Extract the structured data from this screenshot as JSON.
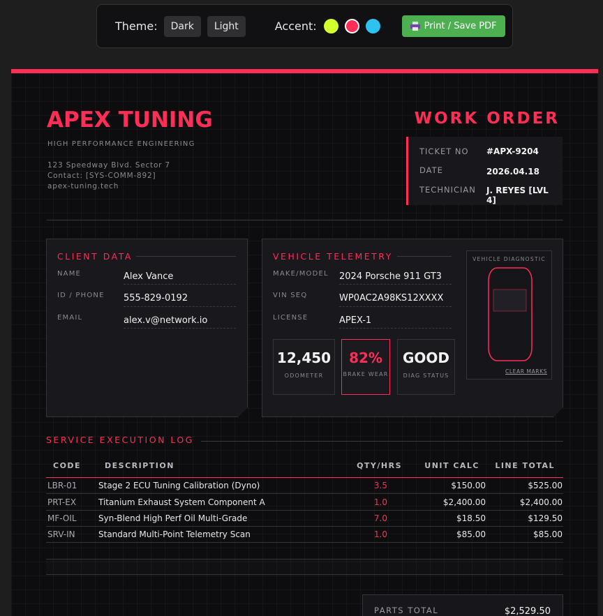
{
  "toolbar": {
    "theme_label": "Theme:",
    "dark_label": "Dark",
    "light_label": "Light",
    "accent_label": "Accent:",
    "accents": [
      "#d4ff2f",
      "#ff2e57",
      "#2ec2f0"
    ],
    "print_label": "Print / Save PDF",
    "print_icon": "printer-icon"
  },
  "colors": {
    "accent": "#ff2e57",
    "print_button": "#4caf50"
  },
  "company": {
    "name": "APEX TUNING",
    "tagline": "HIGH PERFORMANCE ENGINEERING",
    "address": "123 Speedway Blvd. Sector 7",
    "contact": "Contact: [SYS-COMM-892]",
    "website": "apex-tuning.tech"
  },
  "order": {
    "title": "WORK ORDER",
    "ticket_label": "TICKET NO",
    "ticket_value": "#APX-9204",
    "date_label": "DATE",
    "date_value": "2026.04.18",
    "tech_label": "TECHNICIAN",
    "tech_value": "J. REYES [LVL 4]"
  },
  "client": {
    "title": "CLIENT DATA",
    "name_label": "NAME",
    "name_value": "Alex Vance",
    "id_label": "ID / PHONE",
    "id_value": "555-829-0192",
    "email_label": "EMAIL",
    "email_value": "alex.v@network.io"
  },
  "vehicle": {
    "title": "VEHICLE TELEMETRY",
    "make_label": "MAKE/MODEL",
    "make_value": "2024 Porsche 911 GT3",
    "vin_label": "VIN SEQ",
    "vin_value": "WP0AC2A98KS12XXXX",
    "license_label": "LICENSE",
    "license_value": "APEX-1",
    "stats": [
      {
        "value": "12,450",
        "label": "ODOMETER"
      },
      {
        "value": "82%",
        "label": "BRAKE WEAR"
      },
      {
        "value": "GOOD",
        "label": "DIAG STATUS"
      }
    ],
    "diagnostic_title": "VEHICLE DIAGNOSTIC",
    "clear_marks": "CLEAR MARKS"
  },
  "log": {
    "title": "SERVICE EXECUTION LOG",
    "headers": {
      "code": "CODE",
      "description": "DESCRIPTION",
      "qty": "QTY/HRS",
      "unit": "UNIT CALC",
      "total": "LINE TOTAL"
    },
    "rows": [
      {
        "code": "LBR-01",
        "description": "Stage 2 ECU Tuning Calibration (Dyno)",
        "qty": "3.5",
        "unit": "$150.00",
        "total": "$525.00"
      },
      {
        "code": "PRT-EX",
        "description": "Titanium Exhaust System Component A",
        "qty": "1.0",
        "unit": "$2,400.00",
        "total": "$2,400.00"
      },
      {
        "code": "MF-OIL",
        "description": "Syn-Blend High Perf Oil Multi-Grade",
        "qty": "7.0",
        "unit": "$18.50",
        "total": "$129.50"
      },
      {
        "code": "SRV-IN",
        "description": "Standard Multi-Point Telemetry Scan",
        "qty": "1.0",
        "unit": "$85.00",
        "total": "$85.00"
      }
    ]
  },
  "totals": {
    "parts_label": "PARTS TOTAL",
    "parts_value": "$2,529.50"
  }
}
